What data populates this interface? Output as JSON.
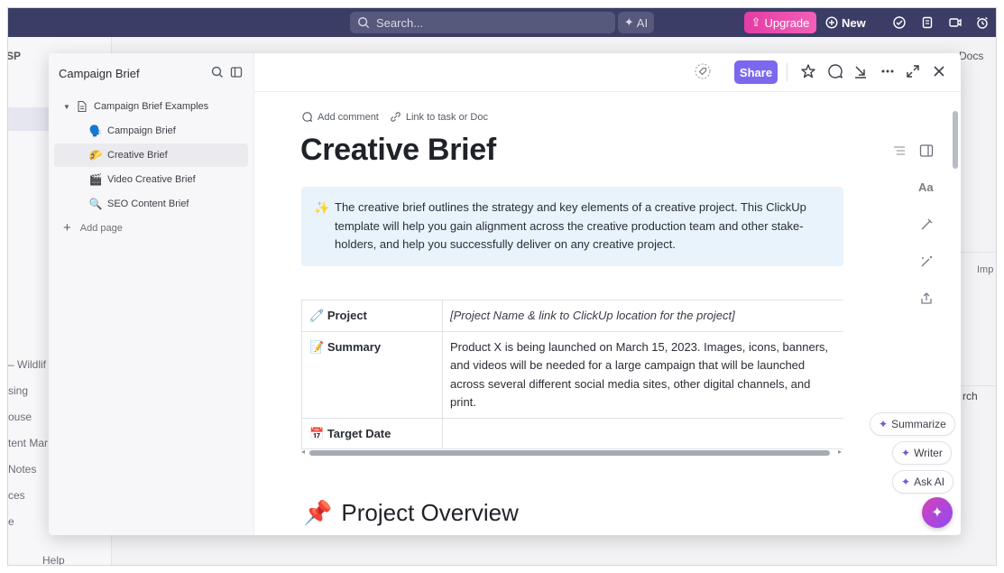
{
  "topbar": {
    "search_placeholder": "Search...",
    "ai_label": "AI",
    "upgrade_label": "Upgrade",
    "new_label": "New"
  },
  "background": {
    "workspace_initials": "SP",
    "docs_label": "Docs",
    "help_label": "Help",
    "import_label": "Imp",
    "search_fragment": "rch",
    "sidebar_fragments": [
      "– Wildlif",
      "sing",
      "ouse",
      "tent Mar",
      "Notes",
      "ces",
      "e"
    ]
  },
  "sidebar": {
    "title": "Campaign Brief",
    "tree": [
      {
        "label": "Campaign Brief Examples",
        "icon": "document-icon"
      },
      {
        "label": "Campaign Brief",
        "icon": "🗣️"
      },
      {
        "label": "Creative Brief",
        "icon": "🌮",
        "selected": true
      },
      {
        "label": "Video Creative Brief",
        "icon": "🎬"
      },
      {
        "label": "SEO Content Brief",
        "icon": "🔍"
      }
    ],
    "add_page_label": "Add page"
  },
  "header": {
    "share_label": "Share"
  },
  "doc": {
    "add_comment_label": "Add comment",
    "link_label": "Link to task or Doc",
    "title": "Creative Brief",
    "callout_icon": "✨",
    "callout_text": "The creative brief outlines the strategy and key elements of a creative project. This ClickUp template will help you gain alignment across the creative production team and other stake-holders, and help you successfully deliver on any creative project.",
    "table": [
      {
        "icon": "🧷",
        "key": "Project",
        "value": "[Project Name & link to ClickUp location for the project]",
        "italic": true
      },
      {
        "icon": "📝",
        "key": "Summary",
        "value": "Product X is being launched on March 15, 2023. Images, icons, banners, and videos will be needed for a large campaign that will be launched across several different social media sites, other digital channels, and print.",
        "italic": false
      },
      {
        "icon": "📅",
        "key": "Target Date",
        "value": "",
        "italic": false
      }
    ],
    "section_icon": "📌",
    "section_title": "Project Overview"
  },
  "ai_pills": {
    "summarize": "Summarize",
    "writer": "Writer",
    "ask_ai": "Ask AI"
  },
  "colors": {
    "accent": "#7b68ee",
    "topbar": "#3b3d66",
    "upgrade": "#e43ca3",
    "callout_bg": "#e8f3fc"
  }
}
